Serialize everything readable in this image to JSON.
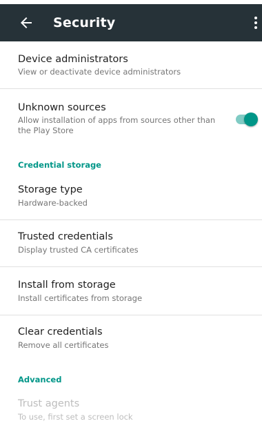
{
  "app_bar": {
    "title": "Security",
    "back_icon": "arrow-back-icon",
    "menu_icon": "more-vert-icon",
    "background": "#263238"
  },
  "items": [
    {
      "primary": "Device administrators",
      "secondary": "View or deactivate device administrators"
    },
    {
      "primary": "Unknown sources",
      "secondary": "Allow installation of apps from sources other than the Play Store",
      "toggle_on": true
    },
    {
      "primary": "Storage type",
      "secondary": "Hardware-backed"
    },
    {
      "primary": "Trusted credentials",
      "secondary": "Display trusted CA certificates"
    },
    {
      "primary": "Install from storage",
      "secondary": "Install certificates from storage"
    },
    {
      "primary": "Clear credentials",
      "secondary": "Remove all certificates"
    },
    {
      "primary": "Trust agents",
      "secondary": "To use, first set a screen lock",
      "disabled": true
    }
  ],
  "sections": {
    "credential_storage": "Credential storage",
    "advanced": "Advanced"
  },
  "colors": {
    "accent": "#009688",
    "accent_light": "#80cbc4"
  }
}
